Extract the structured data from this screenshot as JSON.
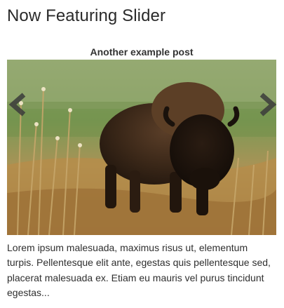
{
  "widget": {
    "title": "Now Featuring Slider"
  },
  "slide": {
    "post_title": "Another example post",
    "image_subject": "bison-in-meadow",
    "excerpt": "Lorem ipsum malesuada, maximus risus ut, elementum turpis. Pellentesque elit ante, egestas quis pellentesque sed, placerat malesuada ex. Etiam eu mauris vel purus tincidunt egestas..."
  },
  "controls": {
    "prev_icon": "chevron-left-icon",
    "next_icon": "chevron-right-icon"
  },
  "colors": {
    "title_text": "#2a2a2a",
    "body_text": "#2f2f2f",
    "grass_green": "#6f8f4a",
    "dry_grass": "#b88c4a",
    "bison_fur": "#3a2a1e"
  }
}
